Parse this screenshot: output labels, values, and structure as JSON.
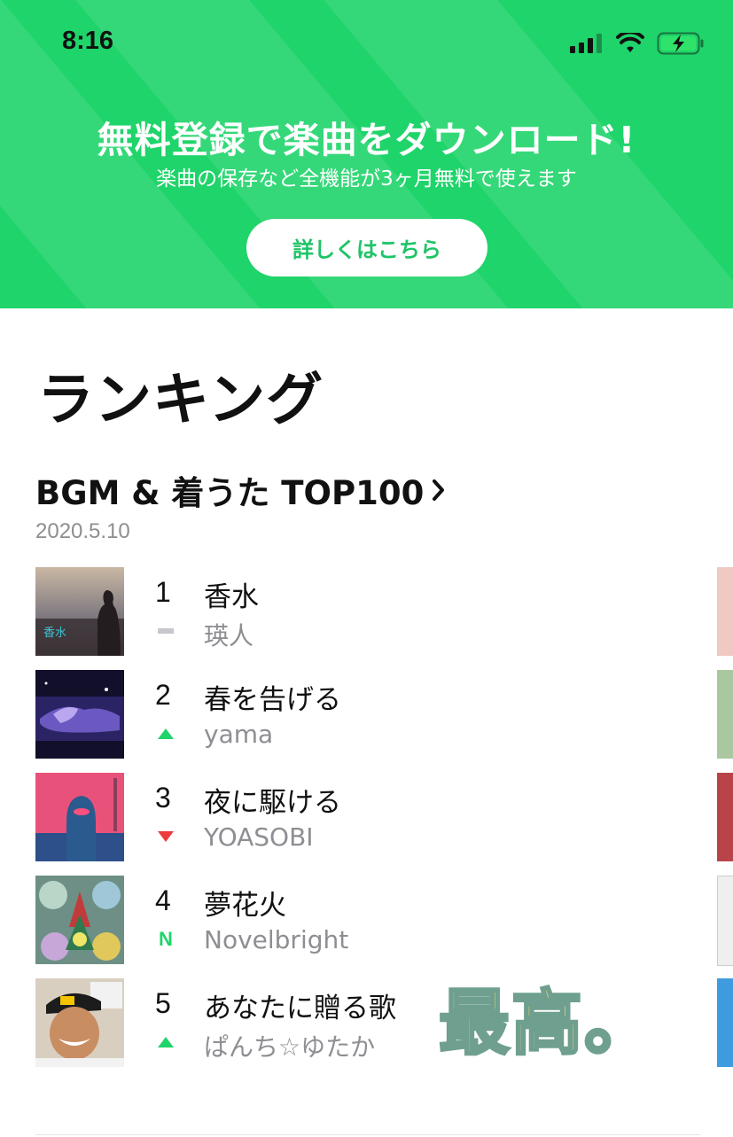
{
  "status_bar": {
    "time": "8:16"
  },
  "banner": {
    "title": "無料登録で楽曲をダウンロード!",
    "subtitle": "楽曲の保存など全機能が3ヶ月無料で使えます",
    "cta_label": "詳しくはこちら"
  },
  "page": {
    "title": "ランキング"
  },
  "chart": {
    "name": "BGM & 着うた TOP100",
    "date": "2020.5.10",
    "items": [
      {
        "rank": "1",
        "title": "香水",
        "artist": "瑛人",
        "trend": "same",
        "jacket_text": "香水"
      },
      {
        "rank": "2",
        "title": "春を告げる",
        "artist": "yama",
        "trend": "up"
      },
      {
        "rank": "3",
        "title": "夜に駆ける",
        "artist": "YOASOBI",
        "trend": "down"
      },
      {
        "rank": "4",
        "title": "夢花火",
        "artist": "Novelbright",
        "trend": "new",
        "trend_label": "N"
      },
      {
        "rank": "5",
        "title": "あなたに贈る歌",
        "artist": "ぱんち☆ゆたか",
        "trend": "up"
      }
    ]
  },
  "overlay": {
    "sticker_text": "最高。"
  },
  "colors": {
    "brand_green": "#1fd46a",
    "down_red": "#ee3b3b",
    "secondary_text": "#8e8e93"
  },
  "icons": [
    "cellular-signal-icon",
    "wifi-icon",
    "battery-charging-icon",
    "chevron-right-icon",
    "trend-same-icon",
    "trend-up-icon",
    "trend-down-icon",
    "trend-new-icon"
  ]
}
